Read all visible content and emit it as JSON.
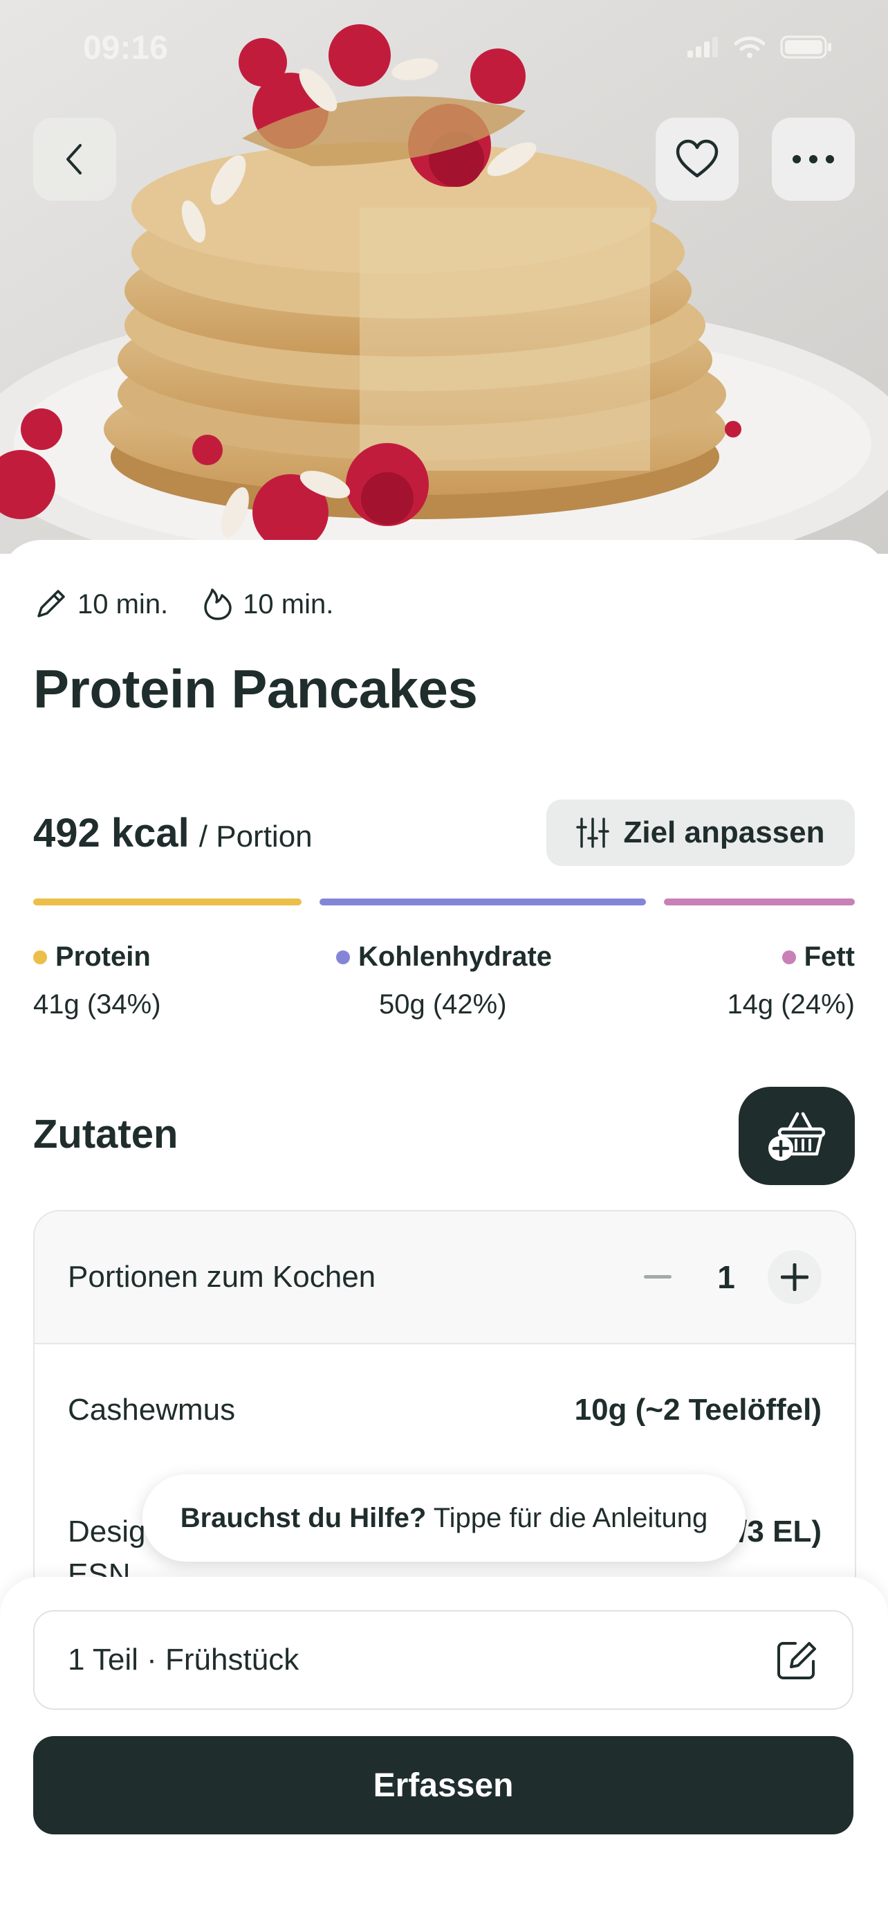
{
  "status_bar": {
    "time": "09:16"
  },
  "recipe": {
    "prep_time": "10 min.",
    "cook_time": "10 min.",
    "title": "Protein Pancakes"
  },
  "nutrition": {
    "kcal": "492 kcal",
    "per": "/ Portion",
    "goal_button": "Ziel anpassen",
    "macros": [
      {
        "label": "Protein",
        "value": "41g (34%)",
        "percent": 34,
        "color": "#ecbe4a"
      },
      {
        "label": "Kohlenhydrate",
        "value": "50g (42%)",
        "percent": 42,
        "color": "#8585d8"
      },
      {
        "label": "Fett",
        "value": "14g (24%)",
        "percent": 24,
        "color": "#c880b6"
      }
    ]
  },
  "ingredients": {
    "heading": "Zutaten",
    "servings_label": "Portionen zum Kochen",
    "servings_count": "1",
    "items": [
      {
        "name": "Cashewmus",
        "amount": "10g (~2 Teelöffel)"
      },
      {
        "name": "Desig",
        "name_line2": "ESN",
        "amount": "20g (2/3 EL)"
      }
    ]
  },
  "toast": {
    "bold": "Brauchst du Hilfe?",
    "text": " Tippe für die Anleitung"
  },
  "footer": {
    "portion_text": "1 Teil · Frühstück",
    "cta_label": "Erfassen"
  },
  "colors": {
    "dark": "#1f2d2c",
    "accent_protein": "#ecbe4a",
    "accent_carbs": "#8585d8",
    "accent_fat": "#c880b6"
  }
}
